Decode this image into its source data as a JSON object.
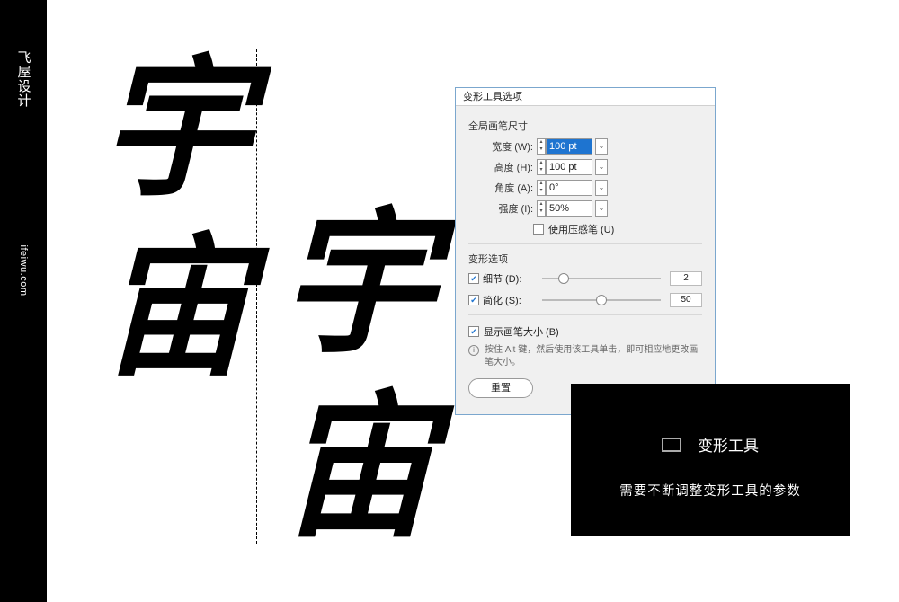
{
  "brand": {
    "top": "飞屋设计",
    "url": "ifeiwu.com"
  },
  "calligraphy": {
    "char1": "宇",
    "char2": "宙"
  },
  "dialog": {
    "title": "变形工具选项",
    "section_brush": "全局画笔尺寸",
    "width_label": "宽度 (W):",
    "width_value": "100 pt",
    "height_label": "高度 (H):",
    "height_value": "100 pt",
    "angle_label": "角度 (A):",
    "angle_value": "0°",
    "intensity_label": "强度 (I):",
    "intensity_value": "50%",
    "pen_pressure": "使用压感笔 (U)",
    "section_warp": "变形选项",
    "detail_label": "细节 (D):",
    "detail_value": "2",
    "simplify_label": "简化 (S):",
    "simplify_value": "50",
    "show_brush": "显示画笔大小 (B)",
    "hint": "按住 Alt 键，然后使用该工具单击，即可相应地更改画笔大小。",
    "reset": "重置"
  },
  "caption": {
    "title": "变形工具",
    "desc": "需要不断调整变形工具的参数"
  }
}
